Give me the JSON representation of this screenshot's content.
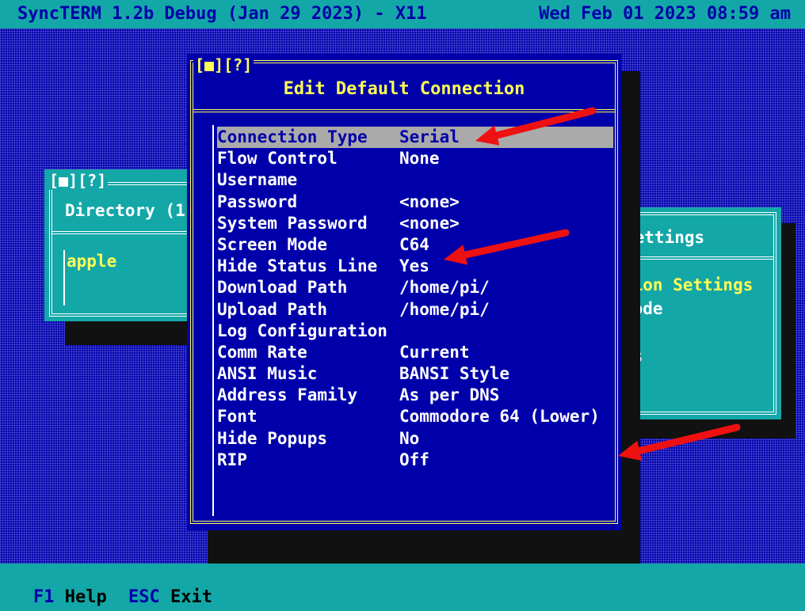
{
  "titlebar": {
    "app": "SyncTERM 1.2b Debug (Jan 29 2023) - X11",
    "datetime": "Wed Feb 01 2023 08:59 am"
  },
  "directory_window": {
    "controls": "[■][?]",
    "title": "Directory (1",
    "items": [
      "apple"
    ]
  },
  "settings_window": {
    "title": "Settings",
    "items": [
      "tion Settings",
      "Mode",
      "t",
      "gs"
    ]
  },
  "dialog": {
    "controls": "[■][?]",
    "title": "Edit Default Connection",
    "rows": [
      {
        "label": "Connection Type",
        "value": "Serial"
      },
      {
        "label": "Flow Control",
        "value": "None"
      },
      {
        "label": "Username",
        "value": ""
      },
      {
        "label": "Password",
        "value": "<none>"
      },
      {
        "label": "System Password",
        "value": "<none>"
      },
      {
        "label": "Screen Mode",
        "value": "C64"
      },
      {
        "label": "Hide Status Line",
        "value": "Yes"
      },
      {
        "label": "Download Path",
        "value": "/home/pi/"
      },
      {
        "label": "Upload Path",
        "value": "/home/pi/"
      },
      {
        "label": "Log Configuration",
        "value": ""
      },
      {
        "label": "Comm Rate",
        "value": "Current"
      },
      {
        "label": "ANSI Music",
        "value": "BANSI Style"
      },
      {
        "label": "Address Family",
        "value": "As per DNS"
      },
      {
        "label": "Font",
        "value": "Commodore 64 (Lower)"
      },
      {
        "label": "Hide Popups",
        "value": "No"
      },
      {
        "label": "RIP",
        "value": "Off"
      }
    ]
  },
  "statusbar": {
    "keys": [
      {
        "key": "F1",
        "text": "Help"
      },
      {
        "key": "ESC",
        "text": "Exit"
      }
    ]
  },
  "colors": {
    "teal": "#14a7a7",
    "blue": "#0000aa",
    "yellow": "#ffff55",
    "selection": "#aaaaaa",
    "annotation_arrow": "#ee1111"
  }
}
